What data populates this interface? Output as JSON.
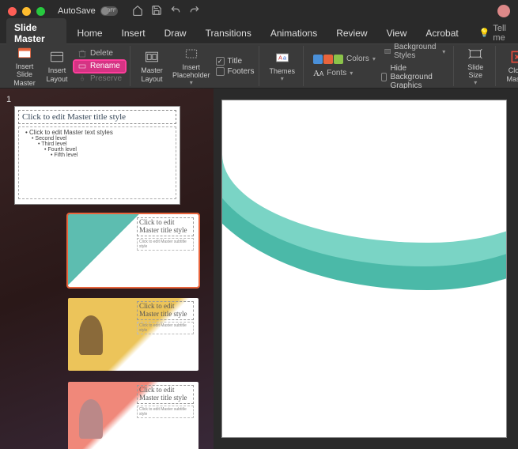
{
  "titlebar": {
    "autosave_label": "AutoSave",
    "autosave_state": "OFF"
  },
  "tabs": {
    "items": [
      "Slide Master",
      "Home",
      "Insert",
      "Draw",
      "Transitions",
      "Animations",
      "Review",
      "View",
      "Acrobat"
    ],
    "active_index": 0,
    "tell_me": "Tell me"
  },
  "ribbon": {
    "insert_slide_master": "Insert Slide\nMaster",
    "insert_layout": "Insert\nLayout",
    "delete": "Delete",
    "rename": "Rename",
    "preserve": "Preserve",
    "master_layout": "Master\nLayout",
    "insert_placeholder": "Insert\nPlaceholder",
    "title_chk": "Title",
    "footers_chk": "Footers",
    "themes": "Themes",
    "colors": "Colors",
    "fonts": "Fonts",
    "bg_styles": "Background Styles",
    "hide_bg": "Hide Background Graphics",
    "slide_size": "Slide\nSize",
    "close_master": "Close\nMaster"
  },
  "sidebar": {
    "slide_number": "1",
    "master": {
      "title_placeholder": "Click to edit Master title style",
      "bullets": [
        "Click to edit Master text styles",
        "Second level",
        "Third level",
        "Fourth level",
        "Fifth level"
      ]
    },
    "layouts": {
      "title_placeholder": "Click to edit Master title style",
      "subtitle_placeholder": "Click to edit Master subtitle style"
    }
  },
  "colors": {
    "accent_teal": "#5dbdb0",
    "accent_teal_light": "#7ad4c5",
    "highlight": "#d63384"
  }
}
